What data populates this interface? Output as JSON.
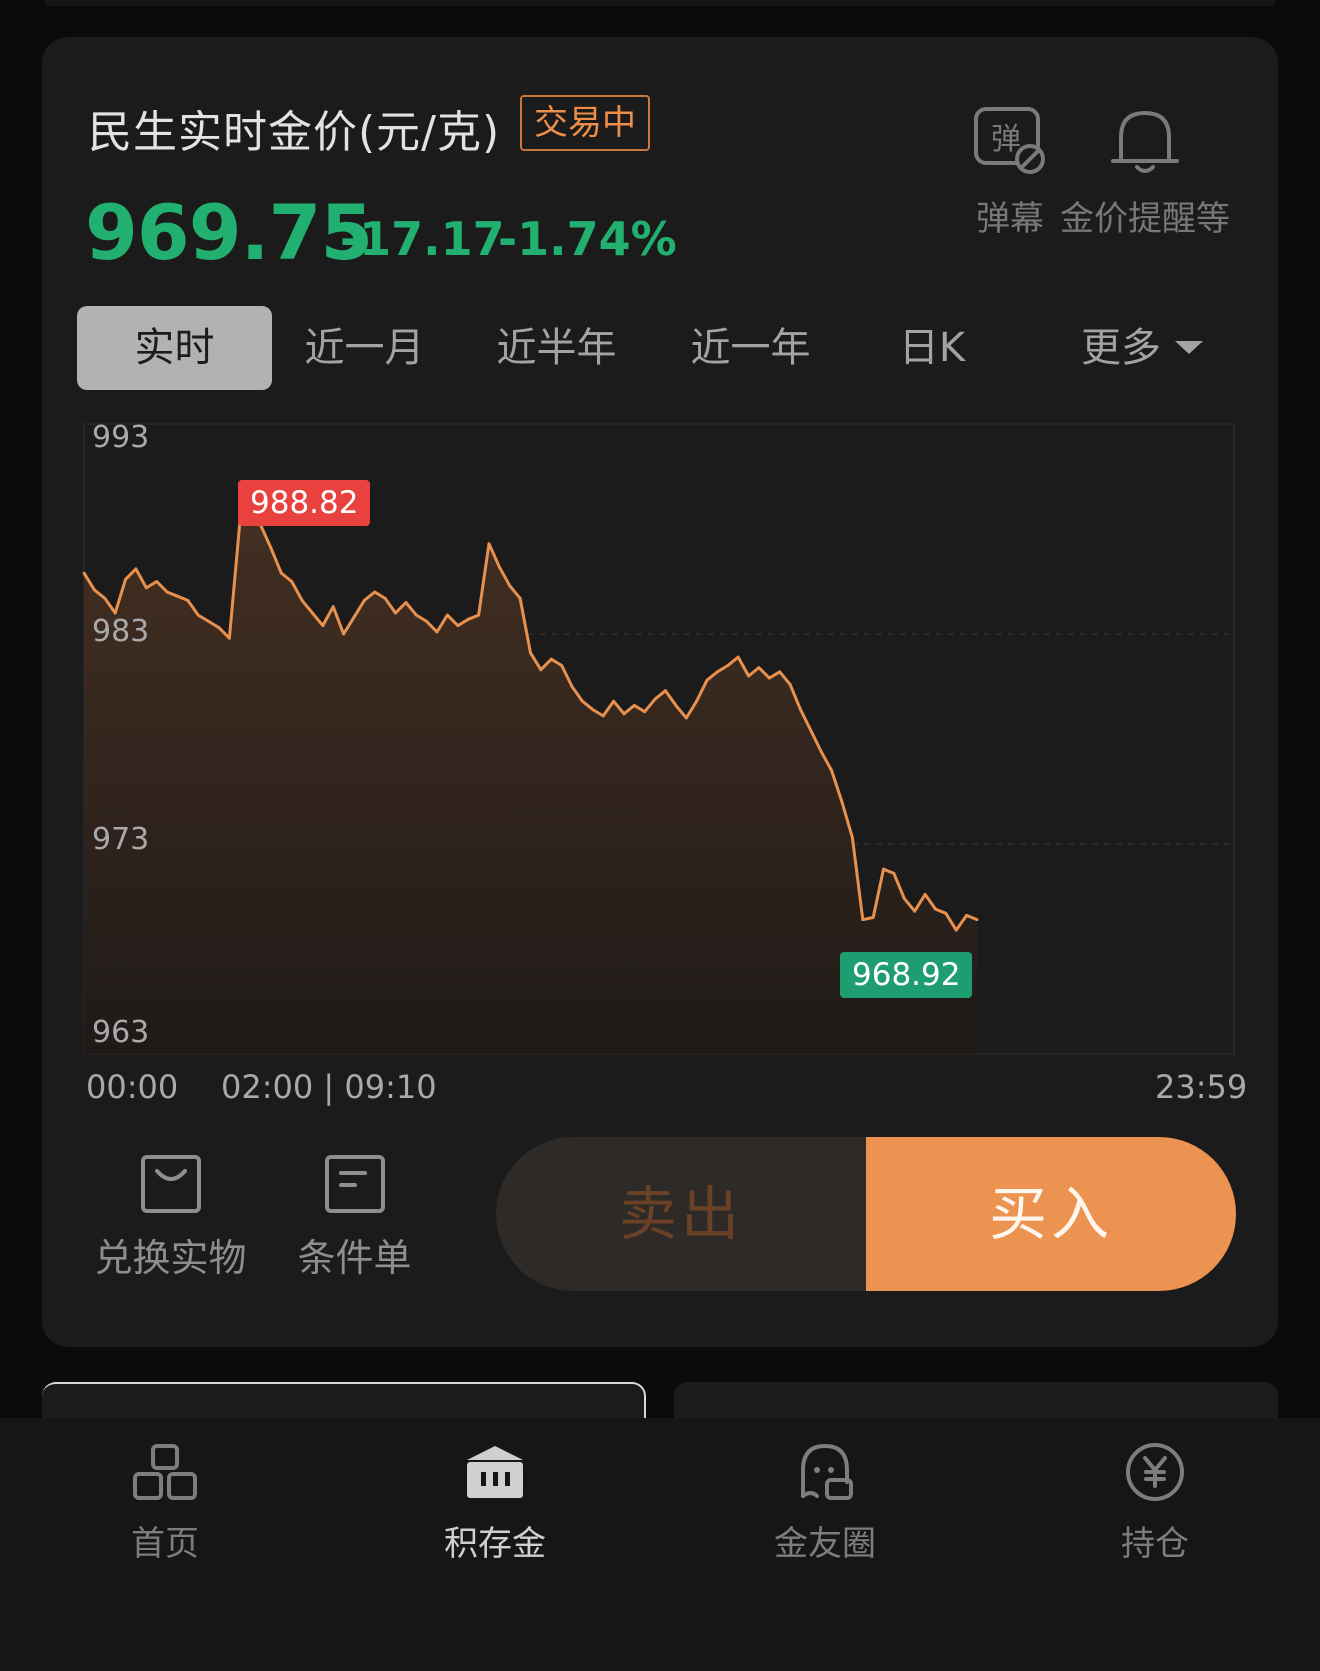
{
  "header": {
    "title": "民生实时金价(元/克)",
    "status_badge": "交易中",
    "price": "969.75",
    "change": "-17.17",
    "change_pct": "-1.74%",
    "price_color": "#21b06f"
  },
  "tools": [
    {
      "label": "弹幕",
      "icon": "danmaku-icon",
      "glyph": "弹"
    },
    {
      "label": "金价提醒等",
      "icon": "bell-icon"
    }
  ],
  "tabs": [
    {
      "label": "实时",
      "active": true
    },
    {
      "label": "近一月"
    },
    {
      "label": "近半年"
    },
    {
      "label": "近一年"
    },
    {
      "label": "日K"
    },
    {
      "label": "更多"
    }
  ],
  "chart_data": {
    "type": "line",
    "title": "",
    "xlabel": "",
    "ylabel": "",
    "ylim": [
      963,
      993
    ],
    "y_ticks": [
      993,
      983,
      973,
      963
    ],
    "x_tick_labels": [
      "00:00",
      "02:00 | 09:10",
      "23:59"
    ],
    "grid": true,
    "line_color": "#e8914f",
    "max_label": "988.82",
    "min_label": "968.92",
    "series": [
      {
        "values": [
          985.9,
          985.1,
          984.7,
          984.0,
          985.6,
          986.1,
          985.2,
          985.5,
          985.0,
          984.8,
          984.6,
          983.9,
          983.6,
          983.3,
          982.8,
          988.3,
          988.8,
          988.2,
          987.1,
          985.9,
          985.5,
          984.6,
          984.0,
          983.4,
          984.3,
          983.0,
          983.8,
          984.6,
          985.0,
          984.7,
          984.0,
          984.5,
          983.9,
          983.6,
          983.1,
          983.9,
          983.4,
          983.7,
          983.9,
          987.3,
          986.2,
          985.3,
          984.7,
          982.1,
          981.3,
          981.8,
          981.5,
          980.5,
          979.8,
          979.4,
          979.1,
          979.8,
          979.2,
          979.6,
          979.3,
          979.9,
          980.3,
          979.6,
          979.0,
          979.8,
          980.8,
          981.2,
          981.5,
          981.9,
          981.0,
          981.4,
          980.9,
          981.2,
          980.6,
          979.4,
          978.4,
          977.4,
          976.5,
          975.0,
          973.3,
          969.4,
          969.5,
          971.8,
          971.6,
          970.4,
          969.8,
          970.6,
          969.9,
          969.7,
          968.9,
          969.6,
          969.4
        ],
        "name": ""
      }
    ]
  },
  "actions": [
    {
      "label": "兑换实物",
      "icon": "shopping-bag-icon"
    },
    {
      "label": "条件单",
      "icon": "order-form-icon"
    }
  ],
  "trade": {
    "sell": "卖出",
    "buy": "买入",
    "buy_color": "#ec9352"
  },
  "nav": [
    {
      "label": "首页",
      "icon": "home-blocks-icon"
    },
    {
      "label": "积存金",
      "icon": "bank-icon",
      "active": true
    },
    {
      "label": "金友圈",
      "icon": "chat-ghost-icon"
    },
    {
      "label": "持仓",
      "icon": "yen-coin-icon"
    }
  ]
}
